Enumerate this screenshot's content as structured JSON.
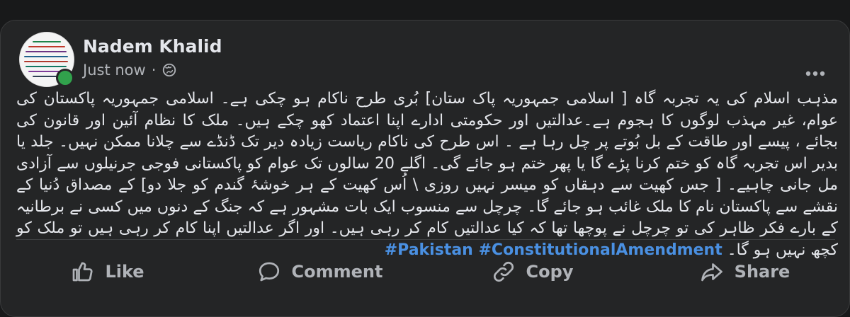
{
  "post": {
    "author": "Nadem Khalid",
    "time": "Just now",
    "visibility_icon": "globe-icon",
    "text": "مذہب اسلام کی یہ تجربہ گاہ [ اسلامی جمہوریہ پاک ستان] بُری طرح ناکام ہو چکی ہے۔ اسلامی جمہوریہ پاکستان کی عوام، غیر مہذب لوگوں کا ہجوم ہے۔عدالتیں اور حکومتی ادارے اپنا اعتماد کھو چکے ہیں۔ ملک کا نظام آئین اور قانون کی بجائے ، پیسے اور طاقت کے بل بُوتے پر چل رہا ہے ۔ اس طرح کی ناکام ریاست زیادہ دیر تک ڈنڈے سے چلانا ممکن نہیں۔ جلد یا بدیر اس تجربہ گاہ کو ختم کرنا پڑے گا یا پھر ختم ہو جائے گی۔ اگلے 20 سالوں تک عوام کو پاکستانی فوجی جرنیلوں سے آزادی مل جانی چاہیے۔ [ جس کھیت سے دہقاں کو میسر نہیں روزی \\ اُس کھیت کے ہر خوشۂ گندم کو جلا دو] کے مصداق دُنیا کے نقشے سے پاکستان نام کا ملک غائب ہو جائے گا۔ چرچل سے منسوب ایک بات مشہور ہے کہ جنگ کے دنوں میں کسی نے برطانیہ کے بارے فکر ظاہر کی تو چرچل نے پوچھا تھا کہ کیا عدالتیں کام کر رہی ہیں۔ اور اگر عدالتیں اپنا کام کر رہی ہیں تو ملک کو کچھ نہیں ہو گا۔",
    "hashtags": "#Pakistan #ConstitutionalAmendment"
  },
  "actions": {
    "like": "Like",
    "comment": "Comment",
    "copy": "Copy",
    "share": "Share"
  },
  "colors": {
    "background": "#242526",
    "text": "#e4e6eb",
    "secondary": "#b0b3b8",
    "hashtag": "#4a90e2",
    "online": "#31a24c"
  }
}
